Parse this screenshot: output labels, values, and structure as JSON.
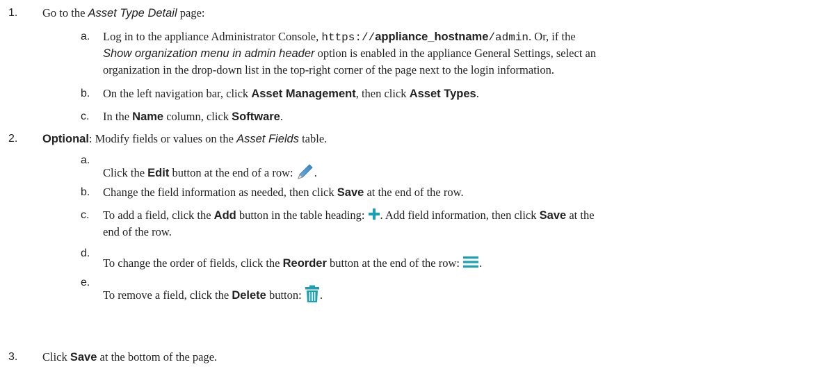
{
  "steps": [
    {
      "num": "1.",
      "pre": "Go to the ",
      "em": "Asset Type Detail",
      "post": " page:",
      "substeps": {
        "a": {
          "letter": "a.",
          "l1_pre": "Log in to the appliance Administrator Console, ",
          "url_pre": "https://",
          "url_host": "appliance_hostname",
          "url_post": "/admin",
          "l1_mid": ". Or, if the",
          "l2_em": "Show organization menu in admin header",
          "l2_post": " option is enabled in the appliance General Settings, select an",
          "l3": "organization in the drop-down list in the top-right corner of the page next to the login information."
        },
        "b": {
          "letter": "b.",
          "pre": "On the left navigation bar, click ",
          "bold1": "Asset Management",
          "mid": ", then click ",
          "bold2": "Asset Types",
          "post": "."
        },
        "c": {
          "letter": "c.",
          "pre": "In the ",
          "bold1": "Name",
          "mid": " column, click ",
          "bold2": "Software",
          "post": "."
        }
      }
    },
    {
      "num": "2.",
      "bold": "Optional",
      "pre": ": Modify fields or values on the ",
      "em": "Asset Fields",
      "post": " table.",
      "substeps": {
        "a": {
          "letter": "a.",
          "pre": "Click the ",
          "bold": "Edit",
          "post": " button at the end of a row: ",
          "end": "."
        },
        "b": {
          "letter": "b.",
          "pre": "Change the field information as needed, then click ",
          "bold": "Save",
          "post": " at the end of the row."
        },
        "c": {
          "letter": "c.",
          "pre": "To add a field, click the ",
          "bold": "Add",
          "post": " button in the table heading: ",
          "mid": ". Add field information, then click ",
          "bold2": "Save",
          "post2": " at the",
          "l2": "end of the row."
        },
        "d": {
          "letter": "d.",
          "pre": "To change the order of fields, click the ",
          "bold": "Reorder",
          "post": " button at the end of the row: ",
          "end": "."
        },
        "e": {
          "letter": "e.",
          "pre": "To remove a field, click the ",
          "bold": "Delete",
          "post": " button: ",
          "end": "."
        }
      }
    },
    {
      "num": "3.",
      "pre": "Click ",
      "bold": "Save",
      "post": " at the bottom of the page."
    }
  ],
  "colors": {
    "text": "#222222",
    "icon_teal": "#1aa0b4"
  },
  "icons": [
    "pencil-icon",
    "plus-icon",
    "reorder-icon",
    "trash-icon"
  ]
}
